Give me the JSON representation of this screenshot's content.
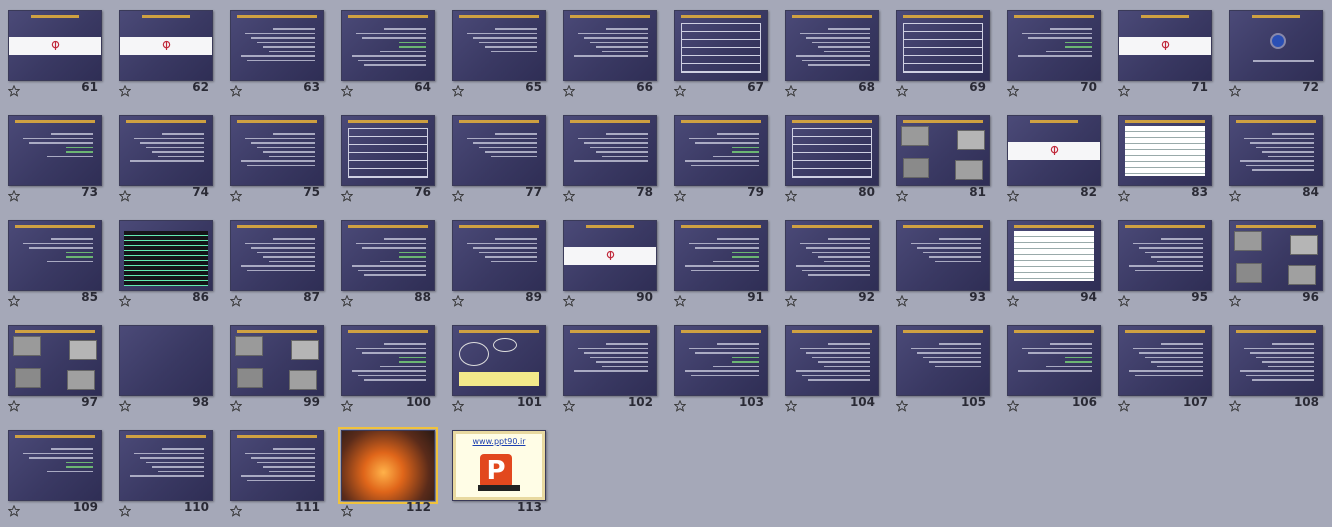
{
  "slides": [
    {
      "n": "61",
      "k": "band"
    },
    {
      "n": "62",
      "k": "band"
    },
    {
      "n": "63",
      "k": "text"
    },
    {
      "n": "64",
      "k": "text"
    },
    {
      "n": "65",
      "k": "text"
    },
    {
      "n": "66",
      "k": "text"
    },
    {
      "n": "67",
      "k": "table"
    },
    {
      "n": "68",
      "k": "text"
    },
    {
      "n": "69",
      "k": "table"
    },
    {
      "n": "70",
      "k": "text"
    },
    {
      "n": "71",
      "k": "band"
    },
    {
      "n": "72",
      "k": "circle"
    },
    {
      "n": "73",
      "k": "text"
    },
    {
      "n": "74",
      "k": "text"
    },
    {
      "n": "75",
      "k": "text"
    },
    {
      "n": "76",
      "k": "table"
    },
    {
      "n": "77",
      "k": "text"
    },
    {
      "n": "78",
      "k": "text"
    },
    {
      "n": "79",
      "k": "text"
    },
    {
      "n": "80",
      "k": "table"
    },
    {
      "n": "81",
      "k": "pics"
    },
    {
      "n": "82",
      "k": "band"
    },
    {
      "n": "83",
      "k": "whitetable"
    },
    {
      "n": "84",
      "k": "text"
    },
    {
      "n": "85",
      "k": "text"
    },
    {
      "n": "86",
      "k": "dark"
    },
    {
      "n": "87",
      "k": "text"
    },
    {
      "n": "88",
      "k": "text"
    },
    {
      "n": "89",
      "k": "text"
    },
    {
      "n": "90",
      "k": "band"
    },
    {
      "n": "91",
      "k": "text"
    },
    {
      "n": "92",
      "k": "text"
    },
    {
      "n": "93",
      "k": "text"
    },
    {
      "n": "94",
      "k": "whitetable"
    },
    {
      "n": "95",
      "k": "text"
    },
    {
      "n": "96",
      "k": "pics"
    },
    {
      "n": "97",
      "k": "pics"
    },
    {
      "n": "98",
      "k": "blank"
    },
    {
      "n": "99",
      "k": "pics"
    },
    {
      "n": "100",
      "k": "text"
    },
    {
      "n": "101",
      "k": "diagram"
    },
    {
      "n": "102",
      "k": "text"
    },
    {
      "n": "103",
      "k": "text"
    },
    {
      "n": "104",
      "k": "text"
    },
    {
      "n": "105",
      "k": "text"
    },
    {
      "n": "106",
      "k": "text"
    },
    {
      "n": "107",
      "k": "text"
    },
    {
      "n": "108",
      "k": "text"
    },
    {
      "n": "109",
      "k": "text"
    },
    {
      "n": "110",
      "k": "text"
    },
    {
      "n": "111",
      "k": "text"
    },
    {
      "n": "112",
      "k": "furnace",
      "selected": true
    },
    {
      "n": "113",
      "k": "ppt"
    }
  ],
  "ppt_slide": {
    "url": "www.ppt90.ir"
  },
  "colors": {
    "background": "#a5a8b8",
    "slide": "#3a3963",
    "title": "#e8b23a",
    "selection": "#f0c23c"
  },
  "icon": "star-outline-icon"
}
